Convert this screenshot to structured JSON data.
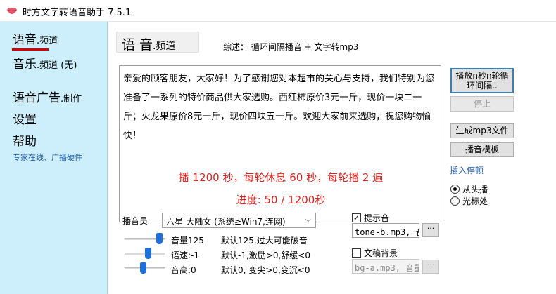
{
  "window": {
    "title": "时方文字转语音助手 7.5.1",
    "icon": "lips-icon"
  },
  "sidebar": {
    "items": [
      {
        "main": "语音",
        "small": ".频道"
      },
      {
        "main": "音乐",
        "small": ".频道 (无)"
      },
      {
        "main": "语音广告",
        "small": ".制作"
      },
      {
        "main": "设置",
        "small": ""
      },
      {
        "main": "帮助",
        "small": ""
      }
    ],
    "help_sub": "专家在线、广播硬件",
    "accent": "#d60000"
  },
  "main": {
    "heading_main": "语 音",
    "heading_small": ".频道",
    "summary": "综述：  循环间隔播音 + 文字转mp3",
    "text": "亲爱的顾客朋友，大家好！为了感谢您对本超市的关心与支持，我们特别为您准备了一系列的特价商品供大家选购。西红柿原价3元一斤，现价一块二一斤；火龙果原价8元一斤，现价四块五一斤。欢迎大家前来选购，祝您购物愉快！",
    "play_info": "播 1200 秒，每轮休息 60 秒，每轮播 2 遍",
    "progress_text": "进度:  50 / 1200秒"
  },
  "buttons": {
    "play_loop": "播放n秒n轮循环间隔..",
    "stop": "停止",
    "gen_mp3": "生成mp3文件",
    "template": "播音模板"
  },
  "insert_pause": "插入停顿",
  "radios": [
    {
      "label": "从头播",
      "checked": true
    },
    {
      "label": "光标处",
      "checked": false
    }
  ],
  "voice": {
    "label": "播音员",
    "selected": "六星-大陆女 (系统≥Win7,连网)"
  },
  "sliders": [
    {
      "label": "音量125",
      "hint": "默认125,过大可能破音",
      "value_fraction": 0.92
    },
    {
      "label": "语速:-1",
      "hint": "默认-1,激励>0,舒缓<0",
      "value_fraction": 0.6
    },
    {
      "label": "音高:0",
      "hint": "默认0, 变尖>0,变沉<0",
      "value_fraction": 0.45
    }
  ],
  "prompt_sound": {
    "label": "提示音",
    "checked": true,
    "file": "tone-b.mp3, 音",
    "browse": "···"
  },
  "background": {
    "label": "文稿背景",
    "checked": false,
    "file": "bg-a.mp3, 音量",
    "browse": "···"
  }
}
